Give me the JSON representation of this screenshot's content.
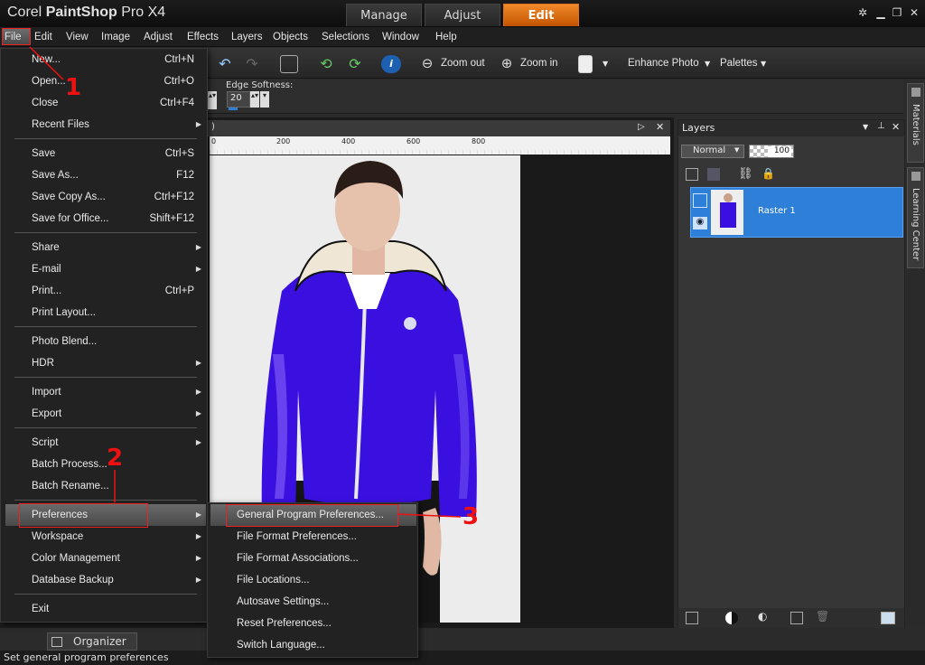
{
  "app": {
    "title_prefix": "Corel ",
    "title_brand": "PaintShop",
    "title_suffix": " Pro X4",
    "tabs": [
      {
        "label": "Manage"
      },
      {
        "label": "Adjust"
      },
      {
        "label": "Edit"
      }
    ]
  },
  "menubar": [
    "File",
    "Edit",
    "View",
    "Image",
    "Adjust",
    "Effects",
    "Layers",
    "Objects",
    "Selections",
    "Window",
    "Help"
  ],
  "toolbar": {
    "zoom_out": "Zoom out",
    "zoom_in": "Zoom in",
    "enhance_photo": "Enhance Photo",
    "palettes": "Palettes"
  },
  "options": {
    "edge_softness_label": "Edge Softness:",
    "edge_softness_value": "20"
  },
  "ruler": [
    "0",
    "200",
    "400",
    "600",
    "800"
  ],
  "file_menu": {
    "groups": [
      [
        {
          "label": "New...",
          "sc": "Ctrl+N"
        },
        {
          "label": "Open...",
          "sc": "Ctrl+O"
        },
        {
          "label": "Close",
          "sc": "Ctrl+F4"
        },
        {
          "label": "Recent Files",
          "arrow": true
        }
      ],
      [
        {
          "label": "Save",
          "sc": "Ctrl+S"
        },
        {
          "label": "Save As...",
          "sc": "F12"
        },
        {
          "label": "Save Copy As...",
          "sc": "Ctrl+F12"
        },
        {
          "label": "Save for Office...",
          "sc": "Shift+F12"
        }
      ],
      [
        {
          "label": "Share",
          "arrow": true
        },
        {
          "label": "E-mail",
          "arrow": true
        },
        {
          "label": "Print...",
          "sc": "Ctrl+P"
        },
        {
          "label": "Print Layout..."
        }
      ],
      [
        {
          "label": "Photo Blend..."
        },
        {
          "label": "HDR",
          "arrow": true
        }
      ],
      [
        {
          "label": "Import",
          "arrow": true
        },
        {
          "label": "Export",
          "arrow": true
        }
      ],
      [
        {
          "label": "Script",
          "arrow": true
        },
        {
          "label": "Batch Process..."
        },
        {
          "label": "Batch Rename..."
        }
      ],
      [
        {
          "label": "Preferences",
          "arrow": true
        },
        {
          "label": "Workspace",
          "arrow": true
        },
        {
          "label": "Color Management",
          "arrow": true
        },
        {
          "label": "Database Backup",
          "arrow": true
        }
      ],
      [
        {
          "label": "Exit"
        }
      ]
    ]
  },
  "prefs_menu": [
    {
      "label": "General Program Preferences..."
    },
    {
      "label": "File Format Preferences..."
    },
    {
      "label": "File Format Associations..."
    },
    {
      "label": "File Locations..."
    },
    {
      "label": "Autosave Settings..."
    },
    {
      "label": "Reset Preferences..."
    },
    {
      "label": "Switch Language..."
    }
  ],
  "layers": {
    "title": "Layers",
    "blend_mode": "Normal",
    "opacity": "100",
    "layer_name": "Raster 1"
  },
  "side_tabs": [
    "Materials",
    "Learning Center"
  ],
  "organizer": "Organizer",
  "status": "Set general program preferences",
  "annotations": [
    "1",
    "2",
    "3"
  ],
  "colors": {
    "accent": "#e06a10",
    "highlight": "#2e7fd8",
    "jacket": "#3a10e0",
    "annotation": "#e11111"
  }
}
